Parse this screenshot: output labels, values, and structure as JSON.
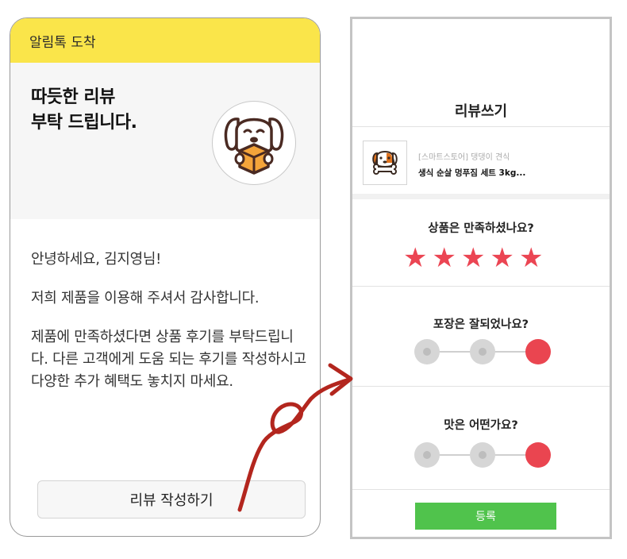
{
  "kakao_card": {
    "header": "알림톡 도착",
    "title_line1": "따듯한 리뷰",
    "title_line2": "부탁 드립니다.",
    "thumbnail_icon": "dog-box-icon",
    "greeting": "안녕하세요, 김지영님!",
    "thanks": "저희 제품을 이용해 주셔서 감사합니다.",
    "request": "제품에 만족하셨다면 상품 후기를 부탁드립니다. 다른 고객에게 도움 되는 후기를 작성하시고 다양한 추가 혜택도 놓치지 마세요.",
    "button_label": "리뷰 작성하기"
  },
  "review_screen": {
    "title": "리뷰쓰기",
    "product": {
      "store": "[스마트스토어] 댕댕이 견식",
      "name": "생식 순살 멍푸짐 세트 3kg...",
      "thumbnail_icon": "dog-bone-icon"
    },
    "q1": {
      "label": "상품은 만족하셨나요?",
      "rating": 5,
      "max": 5
    },
    "q2": {
      "label": "포장은 잘되었나요?",
      "selected": 3,
      "options": 3
    },
    "q3": {
      "label": "맛은 어떤가요?",
      "selected": 3,
      "options": 3
    },
    "submit_label": "등록"
  },
  "colors": {
    "kakao_yellow": "#fae54a",
    "star_red": "#eb4553",
    "submit_green": "#50c34c",
    "arrow_red": "#b3261e"
  }
}
